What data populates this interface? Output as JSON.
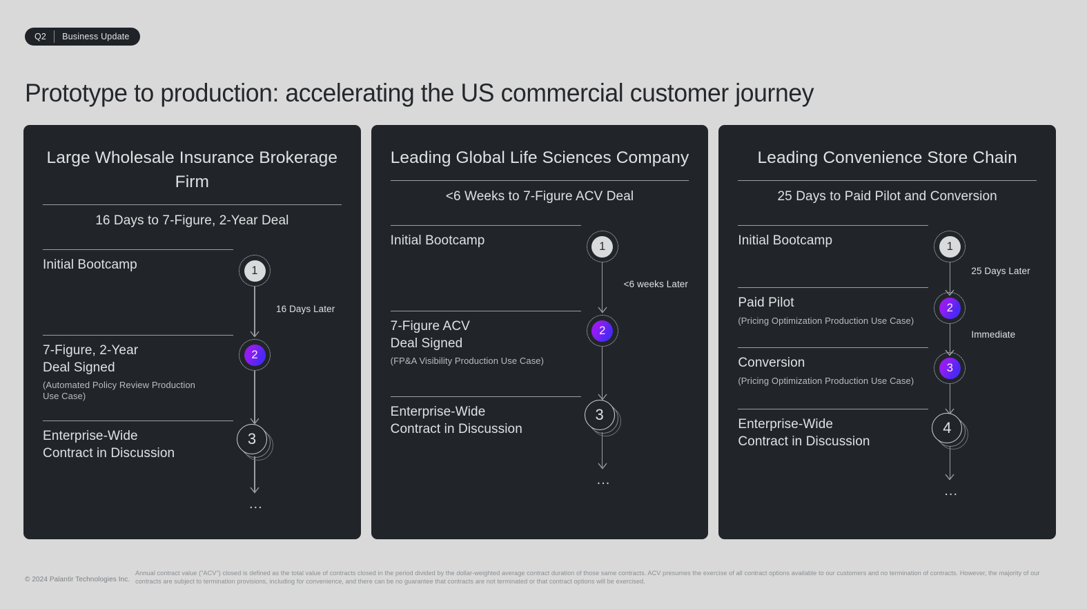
{
  "badge": {
    "quarter": "Q2",
    "label": "Business Update"
  },
  "title": "Prototype to production: accelerating the US commercial customer journey",
  "cards": [
    {
      "title": "Large Wholesale\nInsurance Brokerage Firm",
      "subtitle": "16 Days to 7-Figure, 2-Year Deal",
      "steps": [
        {
          "label": "Initial Bootcamp",
          "note": "",
          "marker": "1",
          "style": "gray"
        },
        {
          "label": "7-Figure, 2-Year\nDeal Signed",
          "note": "(Automated Policy Review Production\nUse Case)",
          "marker": "2",
          "style": "purple"
        },
        {
          "label": "Enterprise-Wide\nContract in Discussion",
          "note": "",
          "marker": "3",
          "style": "stack"
        }
      ],
      "gaps": [
        {
          "label": "16 Days Later"
        }
      ],
      "ellipsis": "..."
    },
    {
      "title": "Leading Global\nLife Sciences Company",
      "subtitle": "<6 Weeks to 7-Figure ACV Deal",
      "steps": [
        {
          "label": "Initial Bootcamp",
          "note": "",
          "marker": "1",
          "style": "gray"
        },
        {
          "label": "7-Figure ACV\nDeal Signed",
          "note": "(FP&A Visibility Production Use Case)",
          "marker": "2",
          "style": "purple"
        },
        {
          "label": "Enterprise-Wide\nContract in Discussion",
          "note": "",
          "marker": "3",
          "style": "stack"
        }
      ],
      "gaps": [
        {
          "label": "<6 weeks Later"
        }
      ],
      "ellipsis": "..."
    },
    {
      "title": "Leading Convenience\nStore Chain",
      "subtitle": "25 Days to Paid Pilot and Conversion",
      "steps": [
        {
          "label": "Initial Bootcamp",
          "note": "",
          "marker": "1",
          "style": "gray"
        },
        {
          "label": "Paid Pilot",
          "note": "(Pricing Optimization Production Use Case)",
          "marker": "2",
          "style": "purple"
        },
        {
          "label": "Conversion",
          "note": "(Pricing Optimization Production Use Case)",
          "marker": "3",
          "style": "purple"
        },
        {
          "label": "Enterprise-Wide\nContract in Discussion",
          "note": "",
          "marker": "4",
          "style": "stack"
        }
      ],
      "gaps": [
        {
          "label": "25 Days Later"
        },
        {
          "label": "Immediate"
        }
      ],
      "ellipsis": "..."
    }
  ],
  "footer": {
    "copyright": "© 2024 Palantir Technologies Inc.",
    "footnote": "Annual contract value (\"ACV\") closed is defined as the total value of contracts closed in the period divided by the dollar-weighted average contract duration of those same contracts. ACV presumes the exercise of all contract options available to our customers and no termination of contracts. However, the majority of our contracts are subject to termination provisions, including for convenience, and there can be no guarantee that contracts are not terminated or that contract options will be exercised."
  },
  "colors": {
    "page_background": "#d9d9d9",
    "card_background": "#212529",
    "accent_purple_start": "#a517ef",
    "accent_purple_end": "#3c2ff6",
    "text_light": "#dfe1e3",
    "rule": "#9aa0a6"
  }
}
